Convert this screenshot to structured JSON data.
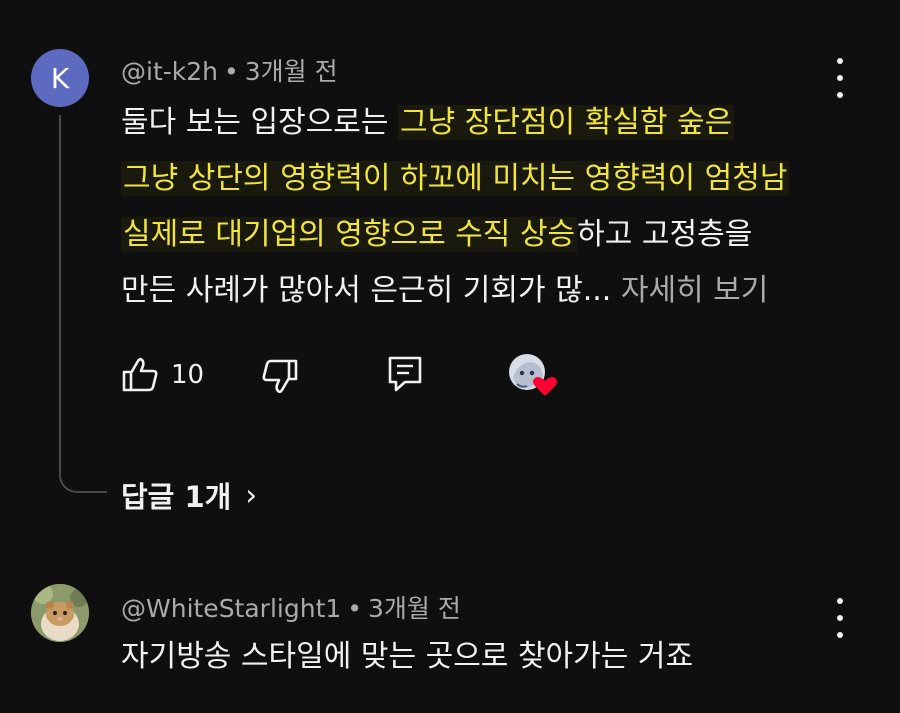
{
  "comments": [
    {
      "avatar_letter": "K",
      "avatar_color": "#5c6bc0",
      "handle": "@it-k2h",
      "separator": "•",
      "time": "3개월 전",
      "lines": [
        {
          "plain": "둘다 보는 입장으로는 ",
          "highlight": "그냥 장단점이 확실함 숲은",
          "rest": ""
        },
        {
          "plain": "",
          "highlight": "그냥 상단의 영향력이 하꼬에 미치는 영향력이 엄청남",
          "rest": ""
        },
        {
          "plain": "",
          "highlight": "실제로 대기업의 영향으로 수직 상승",
          "rest": "하고 고정층을"
        },
        {
          "plain": "만든 사례가 많아서 은근히 기회가 많",
          "ellipsis": "... ",
          "more": "자세히 보기"
        }
      ],
      "like_count": "10",
      "replies_label": "답글 1개",
      "replies_chevron": "›",
      "has_creator_heart": true
    },
    {
      "handle": "@WhiteStarlight1",
      "separator": "•",
      "time": "3개월 전",
      "text": "자기방송 스타일에 맞는 곳으로 찾아가는 거죠"
    }
  ],
  "colors": {
    "background": "#0f0f0f",
    "text": "#f1f1f1",
    "meta": "#aaaaaa",
    "highlight_text": "#f1e53d",
    "heart": "#ff0033"
  },
  "icons": [
    "like-icon",
    "dislike-icon",
    "reply-icon",
    "creator-heart-icon",
    "more-options-icon",
    "chevron-right-icon"
  ]
}
